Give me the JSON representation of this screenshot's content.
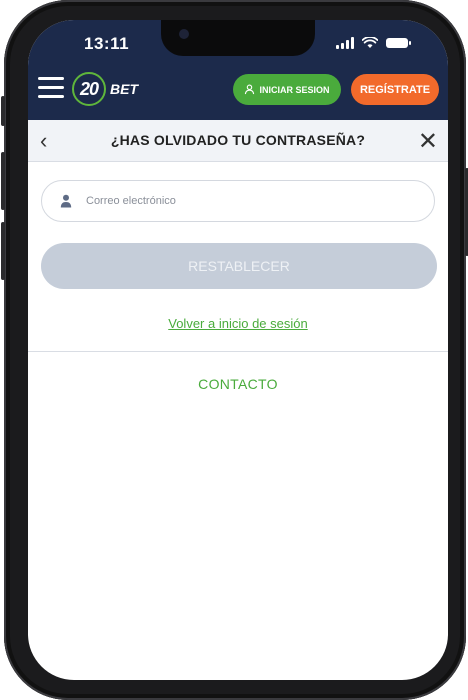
{
  "status_bar": {
    "time": "13:11"
  },
  "header": {
    "logo_number": "20",
    "logo_text": "BET",
    "login_label": "INICIAR SESION",
    "register_label": "REGÍSTRATE"
  },
  "subheader": {
    "title": "¿HAS OLVIDADO TU CONTRASEÑA?"
  },
  "form": {
    "email_placeholder": "Correo electrónico",
    "email_value": "",
    "reset_label": "RESTABLECER",
    "back_link": "Volver a inicio de sesión"
  },
  "footer": {
    "contact_label": "CONTACTO"
  },
  "colors": {
    "header_bg": "#1c2a4b",
    "accent_green": "#4aab3c",
    "accent_orange": "#f26a2b",
    "disabled_button": "#c5cdd9"
  }
}
